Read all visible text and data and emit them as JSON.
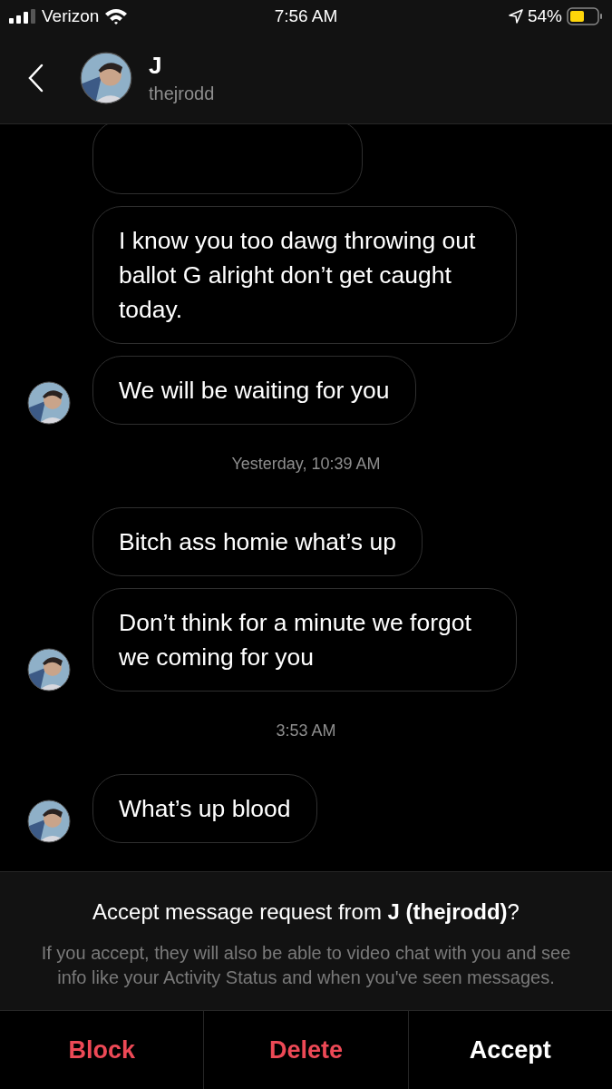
{
  "status_bar": {
    "carrier": "Verizon",
    "time": "7:56 AM",
    "battery": "54%"
  },
  "header": {
    "name": "J",
    "username": "thejrodd"
  },
  "feed": [
    {
      "kind": "cut_message"
    },
    {
      "kind": "message",
      "text": "I know you too dawg throwing out ballot G alright don’t get caught today.",
      "avatar": false
    },
    {
      "kind": "message",
      "text": "We will be waiting for you",
      "avatar": true
    },
    {
      "kind": "timestamp",
      "text": "Yesterday, 10:39 AM"
    },
    {
      "kind": "message",
      "text": "Bitch ass homie what’s up",
      "avatar": false
    },
    {
      "kind": "message",
      "text": "Don’t think for a minute we forgot we coming for you",
      "avatar": true
    },
    {
      "kind": "timestamp",
      "text": "3:53 AM"
    },
    {
      "kind": "message",
      "text": "What’s up blood",
      "avatar": true
    }
  ],
  "request": {
    "title": "Accept message request from **J (thejrodd)**?",
    "body": "If you accept, they will also be able to video chat with you and see info like your Activity Status and when you've seen messages."
  },
  "actions": [
    {
      "label": "Block",
      "kind": "destructive"
    },
    {
      "label": "Delete",
      "kind": "destructive"
    },
    {
      "label": "Accept",
      "kind": "default"
    }
  ]
}
